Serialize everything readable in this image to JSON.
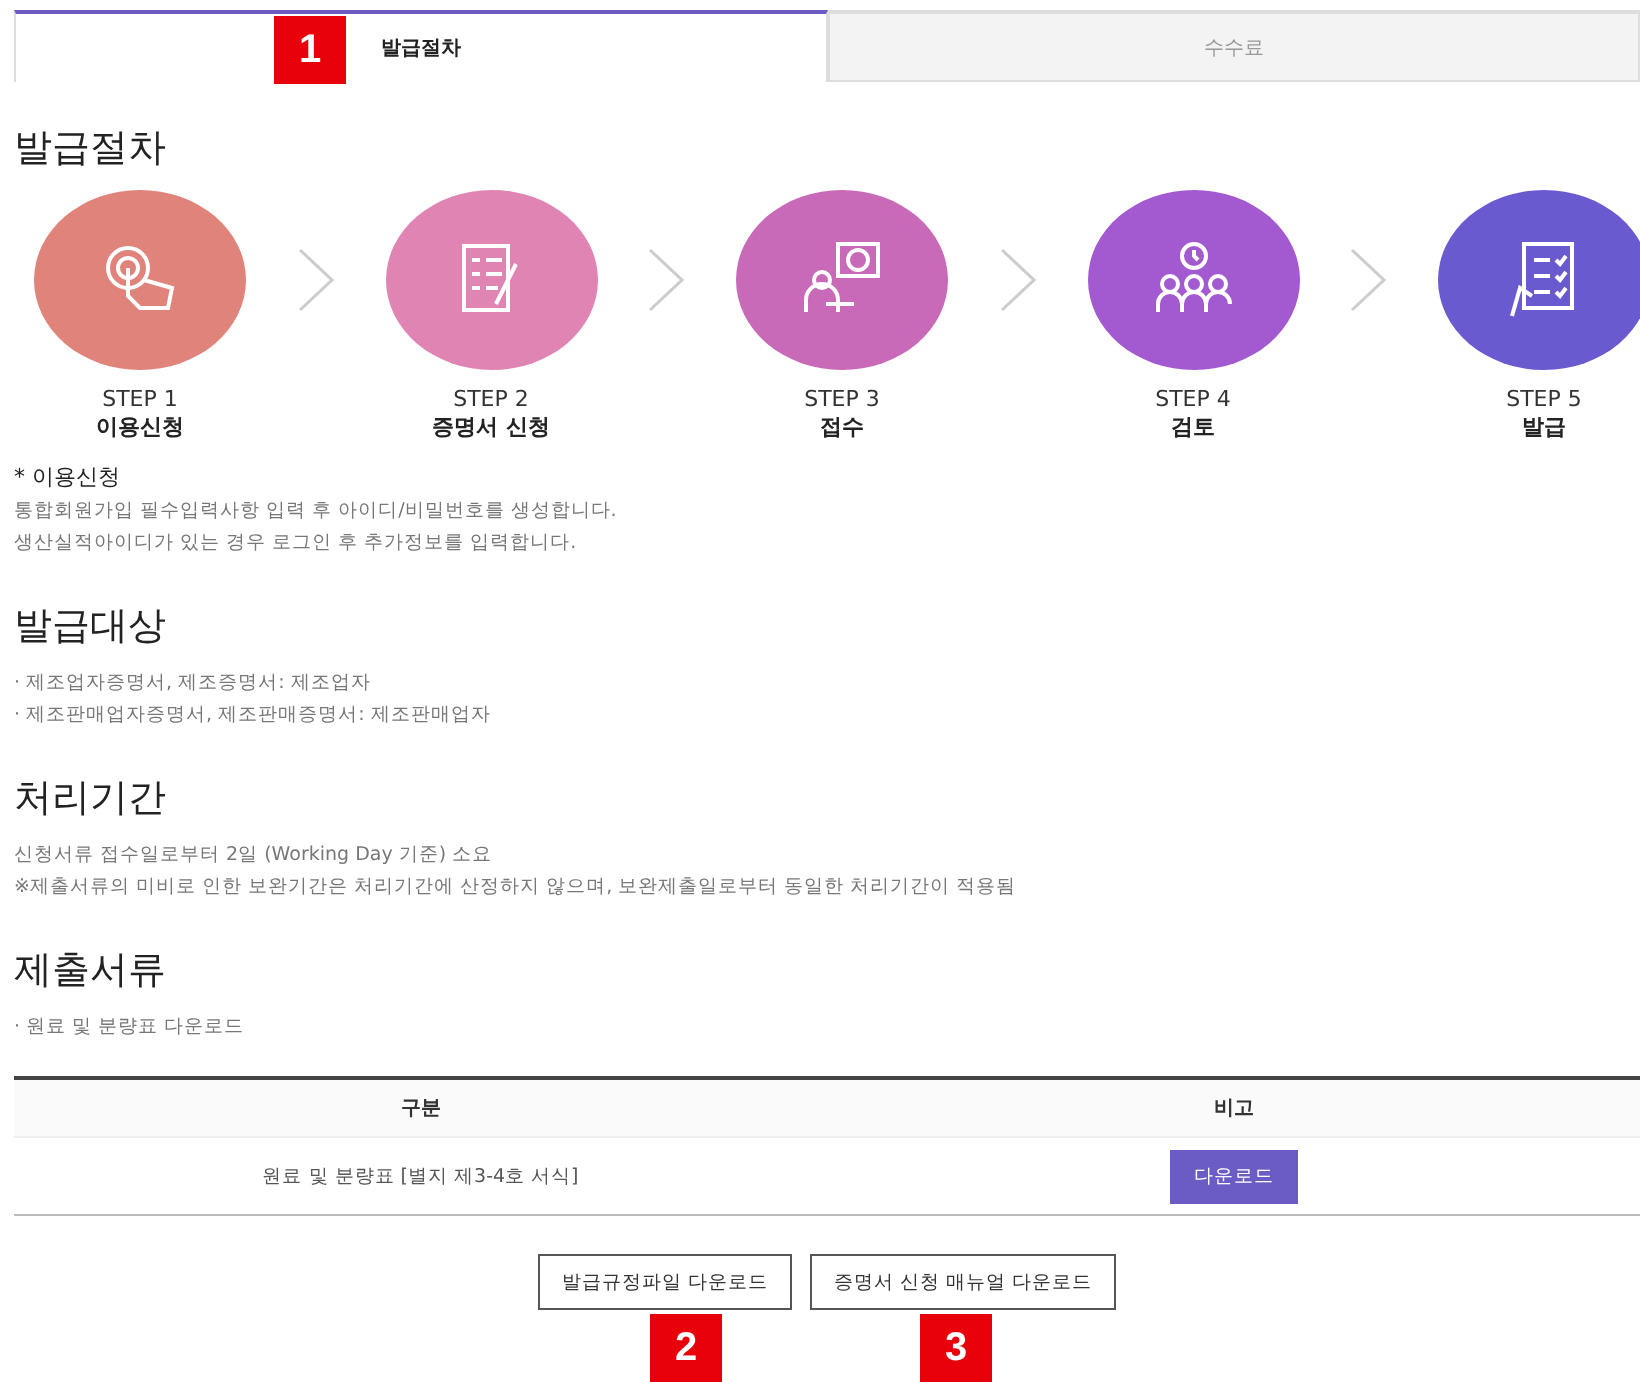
{
  "tabs": [
    {
      "label": "발급절차",
      "selected": true
    },
    {
      "label": "수수료",
      "selected": false
    }
  ],
  "markers": [
    "1",
    "2",
    "3"
  ],
  "sections": [
    {
      "title": "발급절차"
    }
  ],
  "steps": [
    {
      "step": "STEP 1",
      "name": "이용신청",
      "color": "#e0837b"
    },
    {
      "step": "STEP 2",
      "name": "증명서 신청",
      "color": "#e085b3"
    },
    {
      "step": "STEP 3",
      "name": "접수",
      "color": "#c96ab9"
    },
    {
      "step": "STEP 4",
      "name": "검토",
      "color": "#a35ad0"
    },
    {
      "step": "STEP 5",
      "name": "발급",
      "color": "#6a5ad0"
    }
  ],
  "note": {
    "title": "* 이용신청",
    "lines": [
      "통합회원가입 필수입력사항 입력 후 아이디/비밀번호를 생성합니다.",
      "생산실적아이디가 있는 경우 로그인 후 추가정보를 입력합니다."
    ]
  },
  "targets": {
    "title": "발급대상",
    "items": [
      "· 제조업자증명서, 제조증명서: 제조업자",
      "· 제조판매업자증명서, 제조판매증명서: 제조판매업자"
    ]
  },
  "period": {
    "title": "처리기간",
    "lines": [
      "신청서류 접수일로부터 2일 (Working Day 기준) 소요",
      "※제출서류의 미비로 인한 보완기간은 처리기간에 산정하지 않으며, 보완제출일로부터 동일한 처리기간이 적용됨"
    ]
  },
  "documents": {
    "title": "제출서류",
    "items": [
      "· 원료 및 분량표 다운로드"
    ]
  },
  "table": {
    "columns": [
      "구분",
      "비고"
    ],
    "rows": [
      {
        "name": "원료 및 분량표 [별지 제3-4호 서식]",
        "action": "다운로드"
      }
    ]
  },
  "buttons": [
    "발급규정파일 다운로드",
    "증명서 신청 매뉴얼 다운로드"
  ]
}
